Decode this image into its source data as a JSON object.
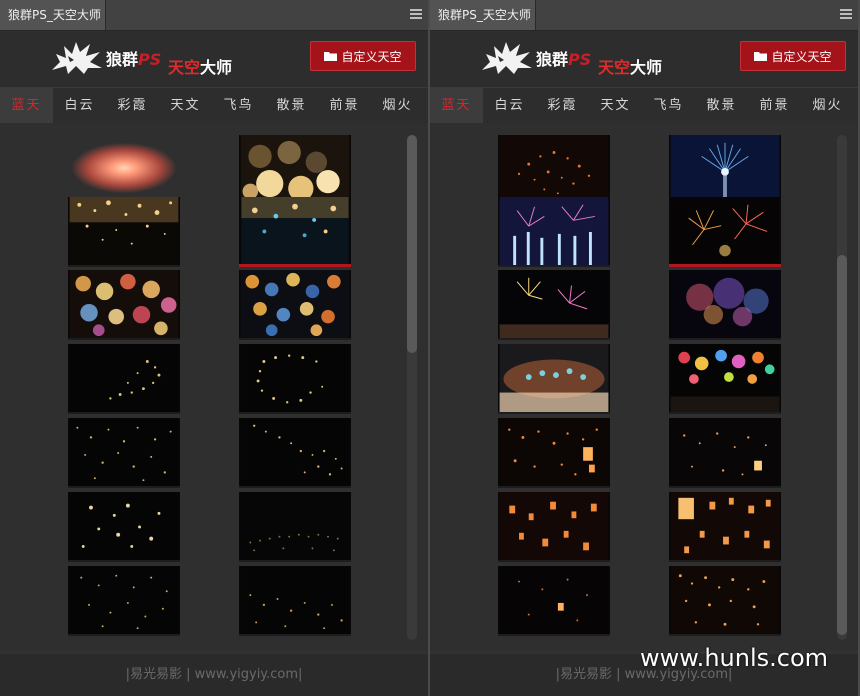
{
  "panels": {
    "left": {
      "tab_title": "狼群PS_天空大师",
      "logo_name": "狼群",
      "logo_ps": "PS",
      "logo_sub_red": "天空",
      "logo_sub_white": "大师",
      "custom_button": "自定义天空",
      "tabs": [
        {
          "label": "蓝天",
          "active": true
        },
        {
          "label": "白云",
          "active": false
        },
        {
          "label": "彩霞",
          "active": false
        },
        {
          "label": "天文",
          "active": false
        },
        {
          "label": "飞鸟",
          "active": false
        },
        {
          "label": "散景",
          "active": false
        },
        {
          "label": "前景",
          "active": false
        },
        {
          "label": "烟火",
          "active": false
        }
      ],
      "footer": "|易光易影 | www.yigyiy.com|"
    },
    "right": {
      "tab_title": "狼群PS_天空大师",
      "logo_name": "狼群",
      "logo_ps": "PS",
      "logo_sub_red": "天空",
      "logo_sub_white": "大师",
      "custom_button": "自定义天空",
      "tabs": [
        {
          "label": "蓝天",
          "active": true
        },
        {
          "label": "白云",
          "active": false
        },
        {
          "label": "彩霞",
          "active": false
        },
        {
          "label": "天文",
          "active": false
        },
        {
          "label": "飞鸟",
          "active": false
        },
        {
          "label": "散景",
          "active": false
        },
        {
          "label": "前景",
          "active": false
        },
        {
          "label": "烟火",
          "active": false
        }
      ],
      "footer": "|易光易影 | www.yigyiy.com|"
    }
  },
  "watermark": "www.hunls.com",
  "colors": {
    "accent_red": "#a41319",
    "active_tab_text": "#d9262c",
    "panel_bg": "#323232"
  },
  "icons": {
    "logo": "wolf-logo-icon",
    "button": "folder-icon",
    "menu": "panel-menu-icon"
  }
}
